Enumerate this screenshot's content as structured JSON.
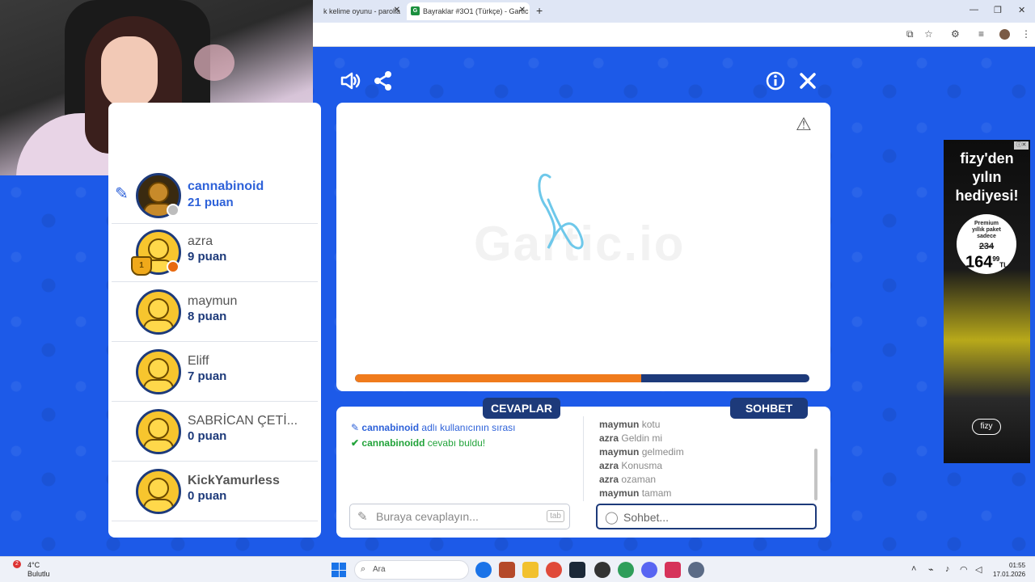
{
  "browser": {
    "tabs": [
      {
        "title": "k kelime oyunu - parolla"
      },
      {
        "title": "Bayraklar #3O1 (Türkçe) - Gartic",
        "favicon": "G"
      }
    ]
  },
  "players": [
    {
      "name": "cannabinoid",
      "score": "21 puan",
      "is_drawer": true,
      "avatar": "photo",
      "status_color": "#bdbdbd"
    },
    {
      "name": "azra",
      "score": "9 puan",
      "trophy": "1",
      "status_color": "#e86a10"
    },
    {
      "name": "maymun",
      "score": "8 puan"
    },
    {
      "name": "Eliff",
      "score": "7 puan"
    },
    {
      "name": "SABRİCAN ÇETİ...",
      "score": "0 puan"
    },
    {
      "name": "KickYamurless",
      "score": "0 puan"
    }
  ],
  "game": {
    "watermark": "Gartic.io",
    "timer_progress": 0.63
  },
  "answers": {
    "tab_label": "CEVAPLAR",
    "lines": [
      {
        "user": "cannabinoid",
        "text": " adlı kullanıcının sırası",
        "icon": "pencil-icon",
        "color": "#2e62d9"
      },
      {
        "user": "cannabinoidd",
        "text": " cevabı buldu!",
        "icon": "check-icon",
        "color": "#22a33a"
      }
    ],
    "placeholder": "Buraya cevaplayın...",
    "tab_hint": "tab"
  },
  "chat": {
    "tab_label": "SOHBET",
    "messages": [
      {
        "user": "maymun",
        "text": " kotu"
      },
      {
        "user": "azra",
        "text": " Geldin mi"
      },
      {
        "user": "maymun",
        "text": " gelmedim"
      },
      {
        "user": "azra",
        "text": " Konusma"
      },
      {
        "user": "azra",
        "text": " ozaman"
      },
      {
        "user": "maymun",
        "text": " tamam"
      }
    ],
    "placeholder": "Sohbet..."
  },
  "ad": {
    "headline_1": "fizy'den",
    "headline_2": "yılın",
    "headline_3": "hediyesi!",
    "offer_label_1": "Premium",
    "offer_label_2": "yıllık paket",
    "offer_label_3": "sadece",
    "old_price": "234",
    "new_price": "164",
    "new_price_cents": "99",
    "currency": "TL",
    "brand": "fizy"
  },
  "taskbar": {
    "weather_temp": "4°C",
    "weather_desc": "Bulutlu",
    "notif_count": "2",
    "search_label": "Ara",
    "time": "01:55",
    "date": "17.01.2026"
  }
}
